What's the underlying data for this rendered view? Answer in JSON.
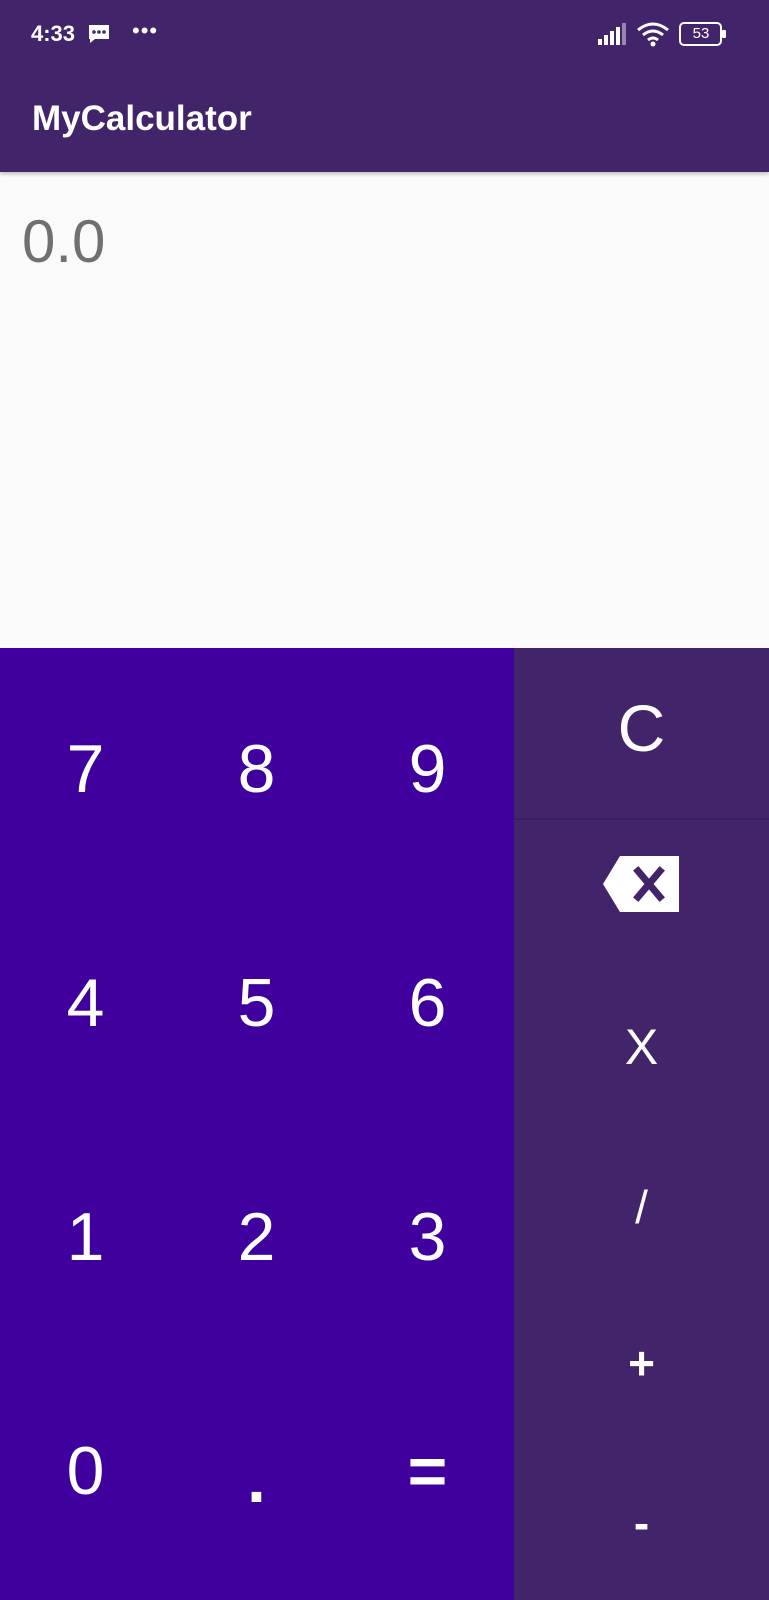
{
  "status_bar": {
    "time": "4:33",
    "overflow": "•••",
    "battery": "53",
    "icons": [
      "message-icon",
      "signal-icon",
      "wifi-icon",
      "battery-icon"
    ]
  },
  "app_bar": {
    "title": "MyCalculator"
  },
  "display": {
    "value": "0.0"
  },
  "keypad": {
    "keys": [
      "7",
      "8",
      "9",
      "4",
      "5",
      "6",
      "1",
      "2",
      "3",
      "0",
      ".",
      "="
    ]
  },
  "operators": {
    "clear": "C",
    "backspace_icon": "backspace-icon",
    "multiply": "X",
    "divide": "/",
    "add": "+",
    "subtract": "-"
  },
  "colors": {
    "header": "#42246b",
    "keypad": "#3f009e",
    "operators": "#42246b",
    "display_background": "#fafafa",
    "display_text": "#707070"
  }
}
